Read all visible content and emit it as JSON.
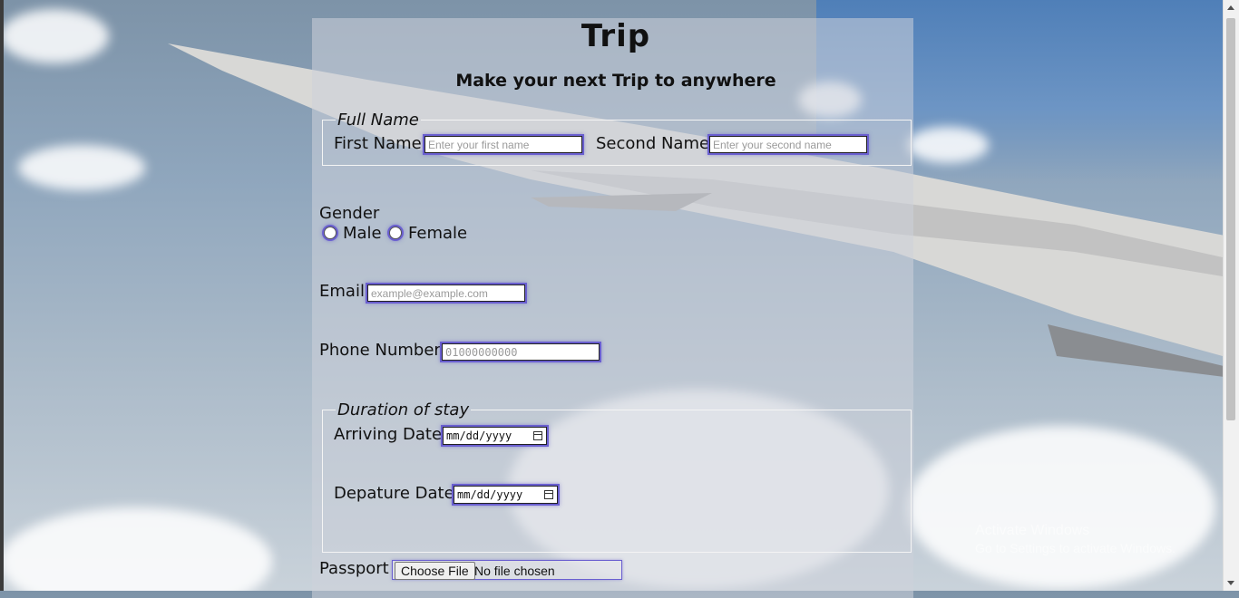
{
  "title": "Trip",
  "subtitle": "Make your next Trip to anywhere",
  "full_name": {
    "legend": "Full Name",
    "first_label": "First Name",
    "first_placeholder": "Enter your first name",
    "second_label": "Second Name",
    "second_placeholder": "Enter your second name"
  },
  "gender": {
    "label": "Gender",
    "options": [
      "Male",
      "Female"
    ]
  },
  "email": {
    "label": "Email",
    "placeholder": "example@example.com"
  },
  "phone": {
    "label": "Phone Number",
    "placeholder": "01000000000"
  },
  "stay": {
    "legend": "Duration of stay",
    "arriving_label": "Arriving Date",
    "arriving_value": "mm/dd/yyyy",
    "departure_label": "Depature Date",
    "departure_value": "mm/dd/yyyy"
  },
  "passport": {
    "label": "Passport",
    "button": "Choose File",
    "status": "No file chosen"
  },
  "watermark": {
    "line1": "Activate Windows",
    "line2": "Go to Settings to activate Windows."
  },
  "colors": {
    "focus_ring": "#6a5fd0",
    "panel": "rgba(205,210,218,0.55)"
  }
}
